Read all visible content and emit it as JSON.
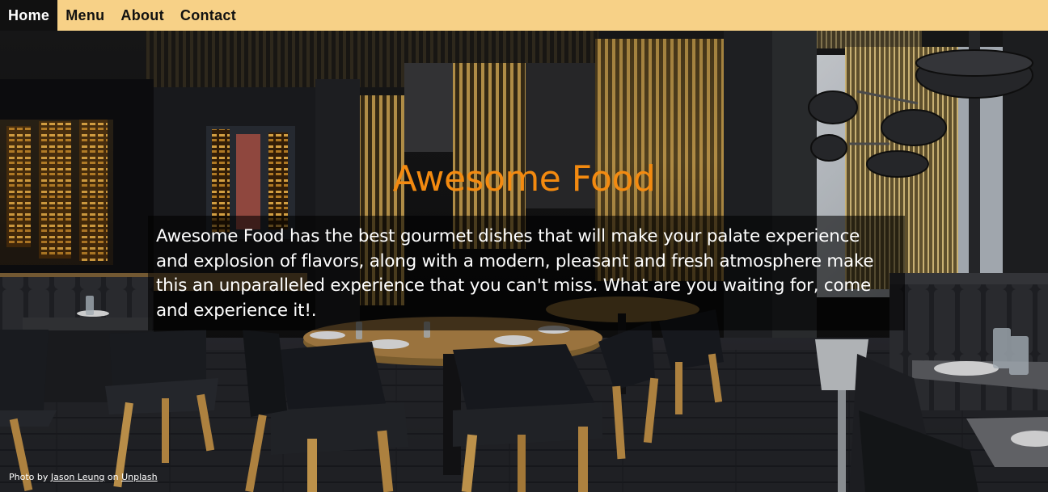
{
  "nav": {
    "items": [
      {
        "label": "Home",
        "active": true
      },
      {
        "label": "Menu",
        "active": false
      },
      {
        "label": "About",
        "active": false
      },
      {
        "label": "Contact",
        "active": false
      }
    ]
  },
  "hero": {
    "title": "Awesome Food",
    "description": "Awesome Food has the best gourmet dishes that will make your palate experience and explosion of flavors, along with a modern, pleasant and fresh atmosphere make this an unparalleled experience that you can't miss. What are you waiting for, come and experience it!."
  },
  "credit": {
    "prefix": "Photo by",
    "author": "Jason Leung",
    "middle": "on",
    "source": "Unplash"
  },
  "colors": {
    "nav_bg": "#f7d187",
    "nav_active_bg": "#111111",
    "title": "#f38a10",
    "overlay": "rgba(0,0,0,0.58)"
  }
}
